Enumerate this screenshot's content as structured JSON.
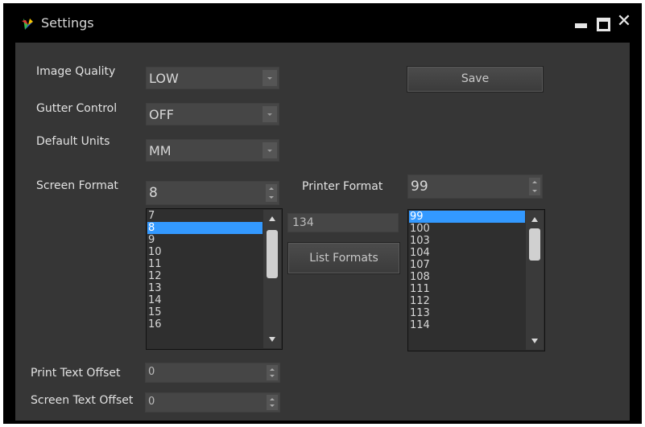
{
  "window": {
    "title": "Settings"
  },
  "labels": {
    "image_quality": "Image Quality",
    "gutter_control": "Gutter Control",
    "default_units": "Default Units",
    "screen_format": "Screen Format",
    "printer_format": "Printer Format",
    "print_text_offset": "Print Text Offset",
    "screen_text_offset": "Screen Text Offset"
  },
  "fields": {
    "image_quality": "LOW",
    "gutter_control": "OFF",
    "default_units": "MM",
    "screen_format": "8",
    "printer_format": "99",
    "format_text": "134",
    "print_text_offset": "0",
    "screen_text_offset": "0"
  },
  "buttons": {
    "save": "Save",
    "list_formats": "List Formats"
  },
  "screen_formats": [
    "7",
    "8",
    "9",
    "10",
    "11",
    "12",
    "13",
    "14",
    "15",
    "16"
  ],
  "screen_format_selected": "8",
  "printer_formats": [
    "99",
    "100",
    "103",
    "104",
    "107",
    "108",
    "111",
    "112",
    "113",
    "114"
  ],
  "printer_format_selected": "99",
  "colors": {
    "selection": "#3399ff",
    "panel": "#363636"
  }
}
